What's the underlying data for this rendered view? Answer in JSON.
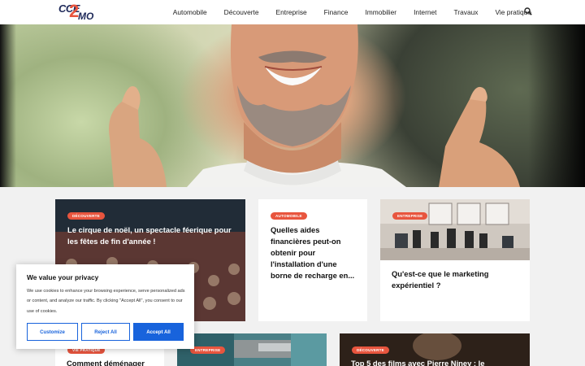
{
  "logo": {
    "top": "CCE",
    "number": "2",
    "bottom": "MO"
  },
  "nav": [
    "Automobile",
    "Découverte",
    "Entreprise",
    "Finance",
    "Immobilier",
    "Internet",
    "Travaux",
    "Vie pratique"
  ],
  "cards": [
    {
      "badge": "Découverte",
      "title": "Le cirque de noël, un spectacle féerique pour les fêtes de fin d'année !"
    },
    {
      "badge": "Automobile",
      "title": "Quelles aides financières peut-on obtenir pour l'installation d'une borne de recharge en..."
    },
    {
      "badge": "Entreprise",
      "title": "Qu'est-ce que le marketing expérientiel ?"
    },
    {
      "badge": "Vie pratique",
      "title": "Comment déménager"
    },
    {
      "badge": "Entreprise",
      "title": ""
    },
    {
      "badge": "Découverte",
      "title": "Top 5 des films avec Pierre Niney : le"
    }
  ],
  "cookie": {
    "title": "We value your privacy",
    "text": "We use cookies to enhance your browsing experience, serve personalized ads or content, and analyze our traffic. By clicking \"Accept All\", you consent to our use of cookies.",
    "customize": "Customize",
    "reject": "Reject All",
    "accept": "Accept All"
  },
  "colors": {
    "accent": "#e8553e",
    "navy": "#1f2a5a",
    "cookie_blue": "#1863dc"
  },
  "icons": {
    "search": "search-icon"
  }
}
